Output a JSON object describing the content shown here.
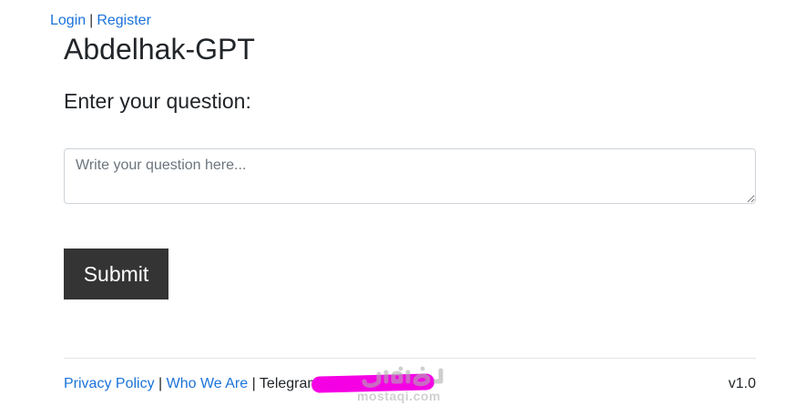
{
  "nav": {
    "login": "Login",
    "separator": "|",
    "register": "Register"
  },
  "header": {
    "title": "Abdelhak-GPT"
  },
  "form": {
    "label": "Enter your question:",
    "placeholder": "Write your question here...",
    "value": "",
    "submit_label": "Submit"
  },
  "footer": {
    "privacy_policy": "Privacy Policy",
    "separator": "|",
    "who_we_are": "Who We Are",
    "telegram_text": "Telegram",
    "version": "v1.0"
  },
  "watermark": {
    "text": "mostaqi.com"
  },
  "colors": {
    "link": "#1a73d9",
    "button_bg": "#343434",
    "redaction": "#f500e4"
  }
}
